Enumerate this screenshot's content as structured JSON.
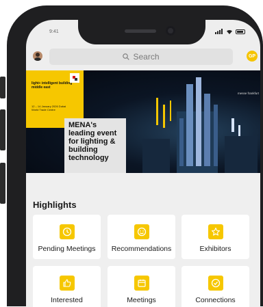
{
  "status_bar": {
    "time": "9:41"
  },
  "header": {
    "search_placeholder": "Search",
    "profile_initials": "GP"
  },
  "banner": {
    "brand": "light+ intelligent building middle east",
    "dates": "12 – 14 January 2026 Dubai World Trade Centre",
    "headline": "MENA's leading event for lighting & building technology",
    "organizer": "messe frankfurt"
  },
  "highlights": {
    "title": "Highlights",
    "tiles": [
      {
        "label": "Pending Meetings",
        "icon": "clock-icon"
      },
      {
        "label": "Recommendations",
        "icon": "smiley-icon"
      },
      {
        "label": "Exhibitors",
        "icon": "star-icon"
      },
      {
        "label": "Interested",
        "icon": "thumbs-up-icon"
      },
      {
        "label": "Meetings",
        "icon": "calendar-icon"
      },
      {
        "label": "Connections",
        "icon": "check-circle-icon"
      }
    ]
  },
  "colors": {
    "accent": "#f6c700",
    "background": "#efefef"
  }
}
